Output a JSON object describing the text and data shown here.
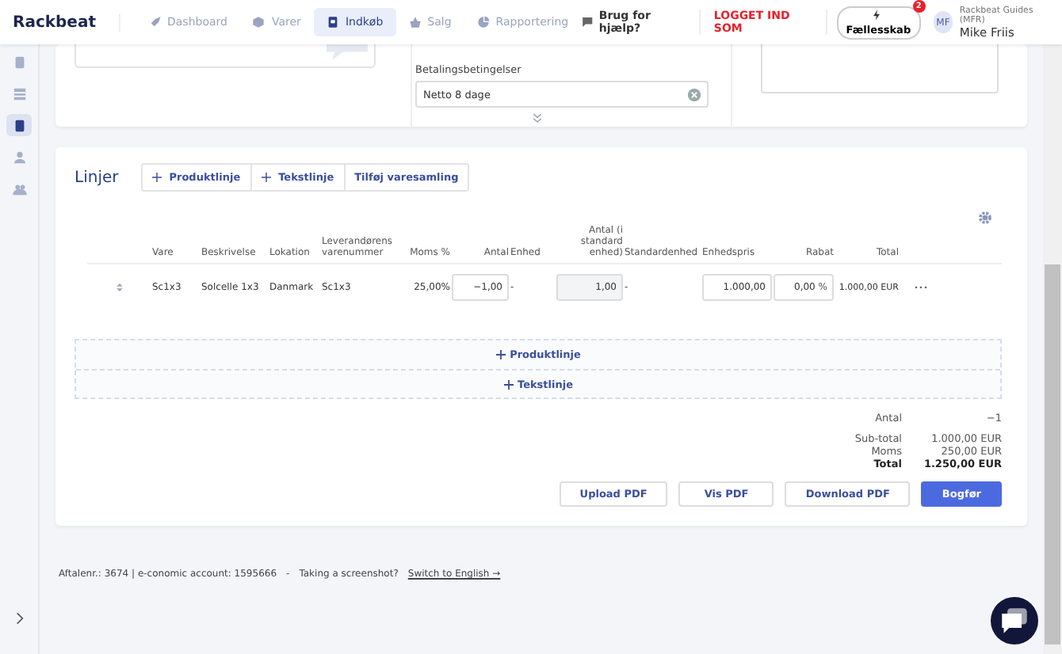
{
  "header": {
    "logo": "Rackbeat",
    "nav": [
      {
        "label": "Dashboard",
        "selected": false
      },
      {
        "label": "Varer",
        "selected": false
      },
      {
        "label": "Indkøb",
        "selected": true
      },
      {
        "label": "Salg",
        "selected": false
      },
      {
        "label": "Rapportering",
        "selected": false
      }
    ],
    "help": "Brug for hjælp?",
    "logged_in_as": "LOGGET IND SOM",
    "community": "Fællesskab",
    "community_badge": "2",
    "user": {
      "initials": "MF",
      "company": "Rackbeat Guides (MFR)",
      "name": "Mike Friis"
    }
  },
  "sidebar": [
    {
      "selected": false
    },
    {
      "selected": false
    },
    {
      "selected": true
    },
    {
      "selected": false
    },
    {
      "selected": false
    }
  ],
  "top_card": {
    "payment_terms": {
      "label": "Betalingsbetingelser",
      "value": "Netto 8 dage"
    }
  },
  "lines": {
    "title": "Linjer",
    "actions": [
      {
        "label": "Produktlinje",
        "plus": true
      },
      {
        "label": "Tekstlinje",
        "plus": true
      },
      {
        "label": "Tilføj varesamling",
        "plus": false
      }
    ],
    "columns": [
      "Vare",
      "Beskrivelse",
      "Lokation",
      "Leverandørens varenummer",
      "Moms %",
      "Antal",
      "Enhed",
      "Antal (i standard enhed)",
      "Standardenhed",
      "Enhedspris",
      "Rabat",
      "Total"
    ],
    "rows": [
      {
        "item": "Sc1x3",
        "description": "Solcelle 1x3",
        "location": "Danmark",
        "supplier_no": "Sc1x3",
        "vat": "25,00%",
        "quantity": "−1,00",
        "unit": "-",
        "std_quantity": "1,00",
        "std_unit": "-",
        "unit_price": "1.000,00",
        "discount": "0,00",
        "discount_unit": "%",
        "total": "1.000,00 EUR"
      }
    ],
    "add_rows": [
      "Produktlinje",
      "Tekstlinje"
    ],
    "summary": [
      {
        "label": "Antal",
        "value": "−1",
        "bold": false
      },
      {
        "label": "Sub-total",
        "value": "1.000,00 EUR",
        "bold": false
      },
      {
        "label": "Moms",
        "value": "250,00 EUR",
        "bold": false
      },
      {
        "label": "Total",
        "value": "1.250,00 EUR",
        "bold": true
      }
    ],
    "buttons": [
      {
        "label": "Upload PDF",
        "primary": false
      },
      {
        "label": "Vis PDF",
        "primary": false
      },
      {
        "label": "Download PDF",
        "primary": false
      },
      {
        "label": "Bogfør",
        "primary": true
      }
    ]
  },
  "footer": {
    "text": "Aftalenr.: 3674 | e-conomic account: 1595666",
    "separator": "-",
    "hint": "Taking a screenshot?",
    "link": "Switch to English →"
  }
}
